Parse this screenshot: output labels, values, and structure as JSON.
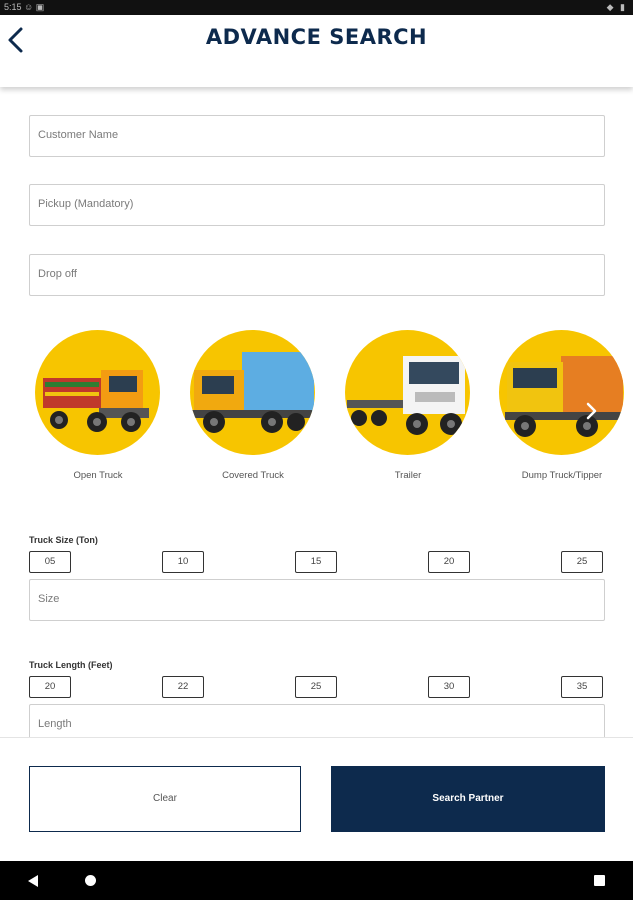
{
  "status_bar": {
    "left": "5:15 ☺ ▣",
    "right": "◆ ▮"
  },
  "header": {
    "title": "ADVANCE SEARCH"
  },
  "form": {
    "customer_name_placeholder": "Customer Name",
    "pickup_placeholder": "Pickup (Mandatory)",
    "dropoff_placeholder": "Drop off"
  },
  "truck_types": [
    {
      "label": "Open Truck"
    },
    {
      "label": "Covered Truck"
    },
    {
      "label": "Trailer"
    },
    {
      "label": "Dump Truck/Tipper"
    }
  ],
  "truck_size": {
    "label": "Truck Size (Ton)",
    "options": [
      "05",
      "10",
      "15",
      "20",
      "25"
    ],
    "placeholder": "Size"
  },
  "truck_length": {
    "label": "Truck Length (Feet)",
    "options": [
      "20",
      "22",
      "25",
      "30",
      "35"
    ],
    "placeholder": "Length"
  },
  "footer": {
    "clear_label": "Clear",
    "search_label": "Search Partner"
  },
  "colors": {
    "primary": "#0d2a4d",
    "accent": "#f7c500"
  },
  "icons": {
    "back": "back-arrow-icon",
    "carousel_next": "chevron-right-icon",
    "nav_back": "nav-back-icon",
    "nav_home": "nav-home-icon",
    "nav_recent": "nav-recent-icon"
  }
}
